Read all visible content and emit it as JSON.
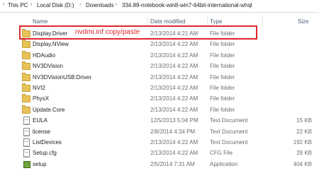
{
  "breadcrumb": [
    "This PC",
    "Local Disk (D:)",
    "Downloads",
    "334.89-notebook-win8-win7-64bit-international-whql"
  ],
  "headers": {
    "name": "Name",
    "date": "Date modified",
    "type": "Type",
    "size": "Size"
  },
  "annotation": "nvdmi.inf copy/paste",
  "files": [
    {
      "name": "Display.Driver",
      "date": "2/13/2014 4:21 AM",
      "type": "File folder",
      "size": "",
      "icon": "folder-icon"
    },
    {
      "name": "Display.NView",
      "date": "2/13/2014 4:22 AM",
      "type": "File folder",
      "size": "",
      "icon": "folder-icon"
    },
    {
      "name": "HDAudio",
      "date": "2/13/2014 4:22 AM",
      "type": "File folder",
      "size": "",
      "icon": "folder-icon"
    },
    {
      "name": "NV3DVision",
      "date": "2/13/2014 4:22 AM",
      "type": "File folder",
      "size": "",
      "icon": "folder-icon"
    },
    {
      "name": "NV3DVisionUSB.Driver",
      "date": "2/13/2014 4:22 AM",
      "type": "File folder",
      "size": "",
      "icon": "folder-icon"
    },
    {
      "name": "NVI2",
      "date": "2/13/2014 4:22 AM",
      "type": "File folder",
      "size": "",
      "icon": "folder-icon"
    },
    {
      "name": "PhysX",
      "date": "2/13/2014 4:22 AM",
      "type": "File folder",
      "size": "",
      "icon": "folder-icon"
    },
    {
      "name": "Update.Core",
      "date": "2/13/2014 4:22 AM",
      "type": "File folder",
      "size": "",
      "icon": "folder-icon"
    },
    {
      "name": "EULA",
      "date": "12/5/2013 5:04 PM",
      "type": "Text Document",
      "size": "15 KB",
      "icon": "document-icon"
    },
    {
      "name": "license",
      "date": "2/8/2014 4:34 PM",
      "type": "Text Document",
      "size": "22 KB",
      "icon": "document-icon"
    },
    {
      "name": "ListDevices",
      "date": "2/13/2014 4:22 AM",
      "type": "Text Document",
      "size": "192 KB",
      "icon": "document-icon"
    },
    {
      "name": "Setup.cfg",
      "date": "2/13/2014 4:22 AM",
      "type": "CFG File",
      "size": "28 KB",
      "icon": "document-icon"
    },
    {
      "name": "setup",
      "date": "2/5/2014 7:31 AM",
      "type": "Application",
      "size": "404 KB",
      "icon": "setup-app-icon"
    }
  ]
}
